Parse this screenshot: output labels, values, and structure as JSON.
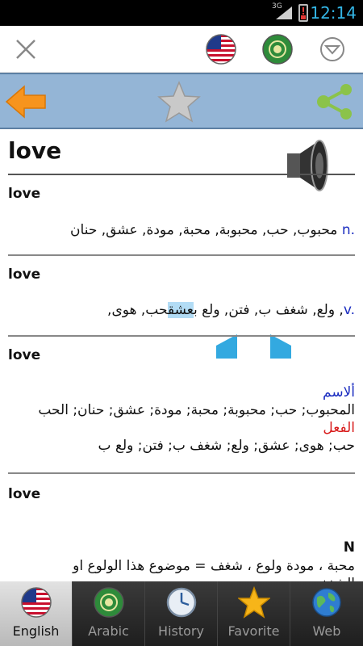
{
  "status_bar": {
    "network": "3G",
    "time": "12:14"
  },
  "toolbar": {
    "close_icon": "close-icon",
    "lang_from_icon": "us-flag-icon",
    "lang_to_icon": "arab-league-flag-icon",
    "menu_icon": "dropdown-circle-icon"
  },
  "nav": {
    "back_icon": "back-arrow-icon",
    "favorite_icon": "star-icon",
    "share_icon": "share-icon"
  },
  "word": {
    "headword": "love",
    "speaker_icon": "speaker-icon"
  },
  "entries": [
    {
      "word": "love",
      "pos": "n.",
      "text": "محبوب, حب, محبوبة, محبة, مودة, عشق, حنان"
    },
    {
      "word": "love",
      "pos": "v.",
      "text_before": "حب, هوى, ",
      "highlight": "عشق",
      "text_after": ", ولع, شغف ب, فتن, ولع ب"
    },
    {
      "word": "love",
      "noun_label": "ألاسم",
      "noun_text": "المحبوب; حب; محبوبة; محبة; مودة; عشق; حنان; الحب",
      "verb_label": "الفعل",
      "verb_text": "حب; هوى; عشق; ولع; شغف ب; فتن; ولع ب"
    },
    {
      "word": "love",
      "n_label": "N",
      "text_line1": "محبة ، مودة ولوع ، شغف = موضوع هذا الولوع او",
      "text_line2": "الشغف"
    }
  ],
  "tabs": [
    {
      "label": "English",
      "icon": "us-flag-icon",
      "active": true
    },
    {
      "label": "Arabic",
      "icon": "arab-league-flag-icon",
      "active": false
    },
    {
      "label": "History",
      "icon": "clock-icon",
      "active": false
    },
    {
      "label": "Favorite",
      "icon": "star-icon",
      "active": false
    },
    {
      "label": "Web",
      "icon": "globe-icon",
      "active": false
    }
  ],
  "colors": {
    "nav_bar": "#94b5d6",
    "accent_orange": "#f7941d",
    "pos_blue": "#1a2cc0",
    "verb_red": "#d81b1b",
    "selection": "#b2dcf5"
  }
}
